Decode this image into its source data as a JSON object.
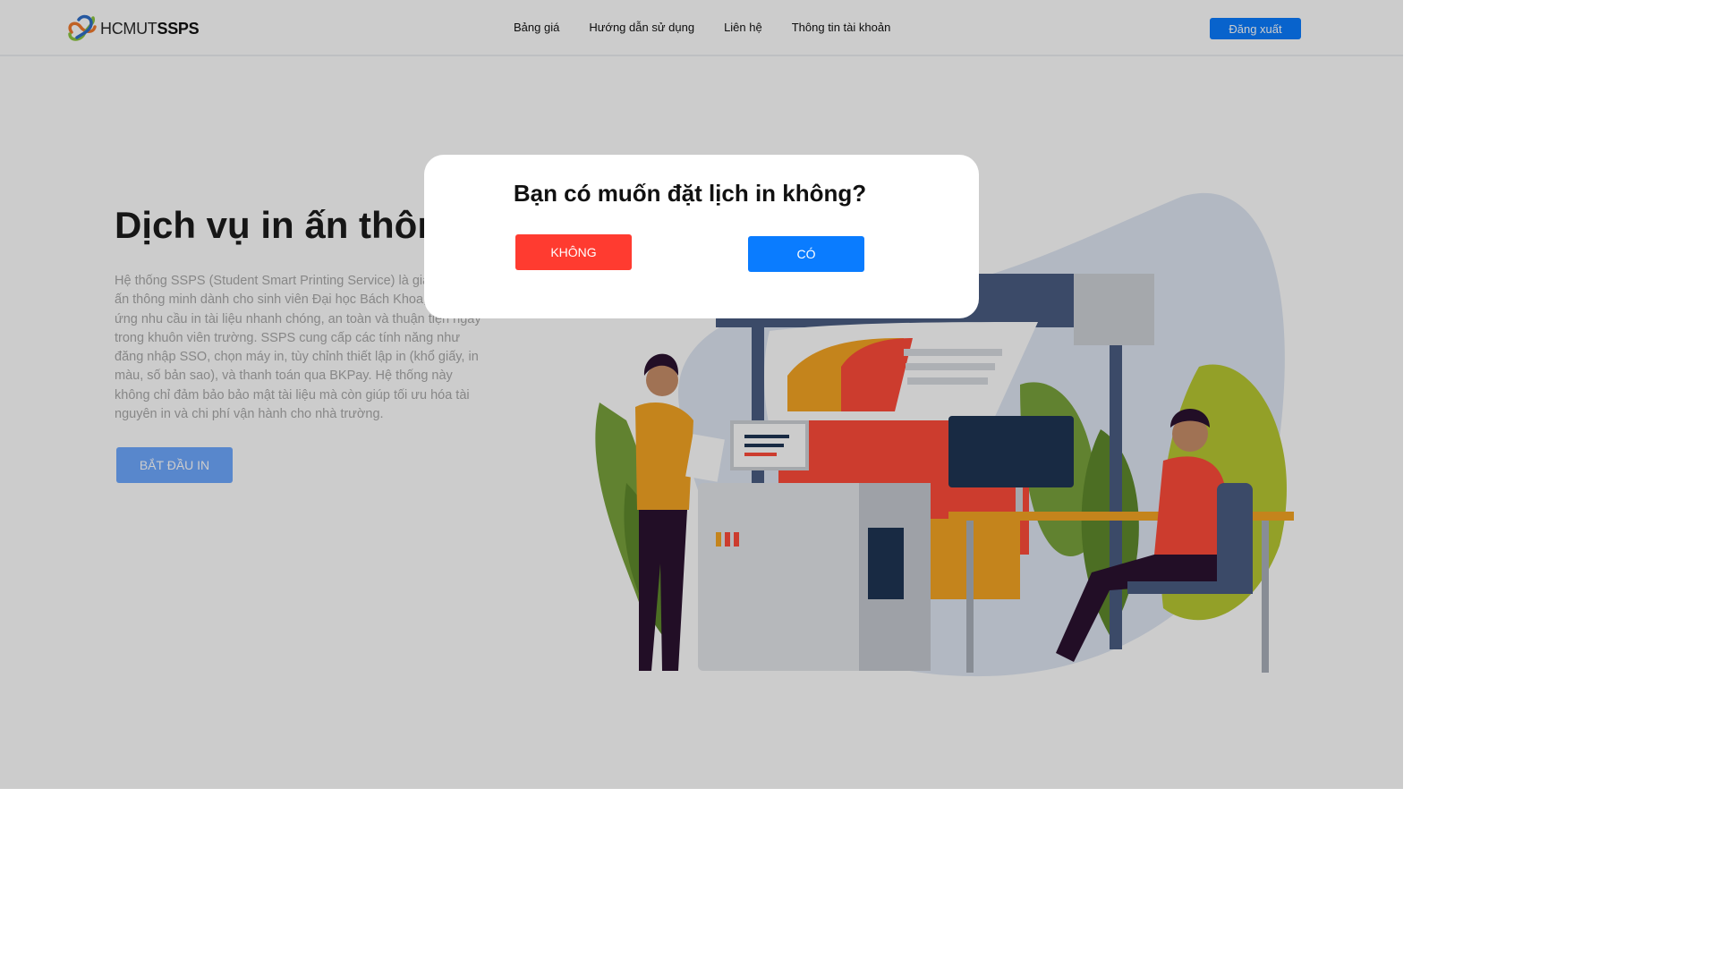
{
  "header": {
    "logo_text_light": "HCMUT",
    "logo_text_bold": "SSPS",
    "nav": [
      {
        "label": "Bảng giá"
      },
      {
        "label": "Hướng dẫn sử dụng"
      },
      {
        "label": "Liên hệ"
      },
      {
        "label": "Thông tin tài khoản"
      }
    ],
    "logout_label": "Đăng xuất"
  },
  "hero": {
    "title": "Dịch vụ in ấn thông minh",
    "description": "Hệ thống SSPS (Student Smart Printing Service) là giải pháp in ấn thông minh dành cho sinh viên Đại học Bách Khoa, giúp đáp ứng nhu cầu in tài liệu nhanh chóng, an toàn và thuận tiện ngay trong khuôn viên trường. SSPS cung cấp các tính năng như đăng nhập SSO, chọn máy in, tùy chỉnh thiết lập in (khổ giấy, in màu, số bản sao), và thanh toán qua BKPay. Hệ thống này không chỉ đảm bảo bảo mật tài liệu mà còn giúp tối ưu hóa tài nguyên in và chi phí vận hành cho nhà trường.",
    "start_label": "BẮT ĐẦU IN"
  },
  "modal": {
    "title": "Bạn có muốn đặt lịch in không?",
    "no_label": "KHÔNG",
    "yes_label": "CÓ"
  },
  "colors": {
    "primary": "#0a7cff",
    "danger": "#ff3b30",
    "start_button": "#6fa9ff"
  },
  "icons": {
    "logo": "hcmut-ssps-logo",
    "illustration": "people-printing-illustration"
  }
}
